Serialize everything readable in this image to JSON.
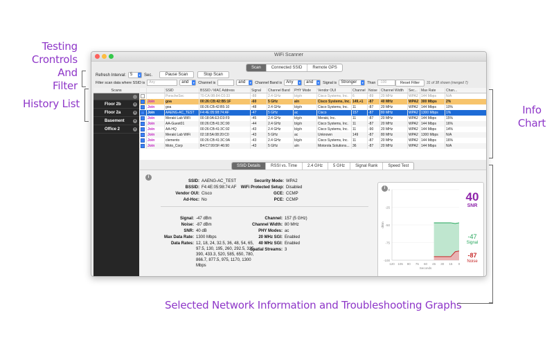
{
  "callouts": {
    "filter_l1": "Testing",
    "filter_l2": "Crontrols",
    "filter_l3": "And Filter",
    "history": "History List",
    "info_l1": "Info",
    "info_l2": "Chart",
    "selected": "Selected Network Information and Troubleshooting Graphs"
  },
  "window": {
    "title": "WiFi Scanner",
    "tabs": [
      "Scan",
      "Connected SSID",
      "Remote GPS"
    ]
  },
  "controls": {
    "refresh_label": "Refresh Interval:",
    "refresh_value": "5",
    "refresh_unit": "Sec.",
    "pause": "Pause Scan",
    "stop": "Stop Scan",
    "filter_label": "Filter scan data where SSID is",
    "ssid_placeholder": "Any",
    "and1": "and",
    "channel_is": "Channel is",
    "and2": "and",
    "channel_band_is": "Channel Band is",
    "band_value": "Any",
    "and3": "and",
    "signal_is": "Signal is",
    "signal_value": "Stronger",
    "than": "Than",
    "than_value": "-100",
    "reset": "Reset Filter",
    "shown": "31 of 38 shown (merged 7)"
  },
  "sidebar": {
    "header": "Scans",
    "items": [
      "Floor 2b",
      "Floor 2a",
      "Basement",
      "Office 2"
    ]
  },
  "table": {
    "headers": [
      "",
      "SSID",
      "BSSID / MAC Address",
      "Signal",
      "Channel Band",
      "PHY Mode",
      "Vendor OUI",
      "Channel",
      "Noise",
      "Channel Width",
      "Sec...",
      "Max Rate",
      "Chan..."
    ],
    "rows": [
      {
        "ssid": "PorscheSvc",
        "bssid": "70:CA:9B:84:C0:33",
        "signal": "-88",
        "band": "2.4 GHz",
        "phy": "b/g/n",
        "vendor": "Cisco Systems, Inc.",
        "channel": "6",
        "noise": "-89",
        "width": "20 MHz",
        "sec": "WPA2",
        "rate": "144 Mbps",
        "chan": "N/A"
      },
      {
        "ssid": "goa",
        "bssid": "00:26:CB:42:B5:1F",
        "signal": "-60",
        "band": "5 GHz",
        "phy": "a/n",
        "vendor": "Cisco Systems, Inc.",
        "channel": "149,+1",
        "noise": "-87",
        "width": "40 MHz",
        "sec": "WPA2",
        "rate": "300 Mbps",
        "chan": "2%"
      },
      {
        "ssid": "goa",
        "bssid": "00:26:CB:42:B5:10",
        "signal": "-48",
        "band": "2.4 GHz",
        "phy": "b/g/n",
        "vendor": "Cisco Systems, Inc.",
        "channel": "11",
        "noise": "-87",
        "width": "20 MHz",
        "sec": "WPA2",
        "rate": "144 Mbps",
        "chan": "10%"
      },
      {
        "ssid": "AAENG-AC_TEST",
        "bssid": "F4:4E:05:98:74:AF",
        "signal": "-47",
        "band": "5 GHz",
        "phy": "ac",
        "vendor": "Cisco",
        "channel": "157",
        "noise": "-87",
        "width": "80 MHz",
        "sec": "WPA2",
        "rate": "1300 Mbps",
        "chan": "1%"
      },
      {
        "ssid": "Meraki Lab WiFi",
        "bssid": "00:18:0A:E3:D3:F9",
        "signal": "-45",
        "band": "2.4 GHz",
        "phy": "b/g/n",
        "vendor": "Meraki, Inc.",
        "channel": "11",
        "noise": "-87",
        "width": "20 MHz",
        "sec": "WPA2",
        "rate": "144 Mbps",
        "chan": "15%"
      },
      {
        "ssid": "AA-Guest01",
        "bssid": "00:26:CB:41:3C:90",
        "signal": "-44",
        "band": "2.4 GHz",
        "phy": "b/g/n",
        "vendor": "Cisco Systems, Inc.",
        "channel": "11",
        "noise": "-87",
        "width": "20 MHz",
        "sec": "WPA2",
        "rate": "144 Mbps",
        "chan": "16%"
      },
      {
        "ssid": "AA-HQ",
        "bssid": "00:26:CB:41:3C:92",
        "signal": "-43",
        "band": "2.4 GHz",
        "phy": "b/g/n",
        "vendor": "Cisco Systems, Inc.",
        "channel": "11",
        "noise": "-90",
        "width": "20 MHz",
        "sec": "WPA2",
        "rate": "144 Mbps",
        "chan": "14%"
      },
      {
        "ssid": "Meraki Lab WiFi",
        "bssid": "02:18:5A:08:20:C0",
        "signal": "-43",
        "band": "5 GHz",
        "phy": "ac",
        "vendor": "Unknown",
        "channel": "149",
        "noise": "-87",
        "width": "80 MHz",
        "sec": "WPA2",
        "rate": "1300 Mbps",
        "chan": "N/A"
      },
      {
        "ssid": "clemento",
        "bssid": "00:26:CB:41:3C:9A",
        "signal": "-43",
        "band": "2.4 GHz",
        "phy": "b/g/n",
        "vendor": "Cisco Systems, Inc.",
        "channel": "11",
        "noise": "-87",
        "width": "20 MHz",
        "sec": "WPA2",
        "rate": "144 Mbps",
        "chan": "16%"
      },
      {
        "ssid": "Moto_Corp",
        "bssid": "B4:C7:99:5F:46:90",
        "signal": "-43",
        "band": "5 GHz",
        "phy": "a/n",
        "vendor": "Motorola Solutions...",
        "channel": "36",
        "noise": "-87",
        "width": "20 MHz",
        "sec": "WPA2",
        "rate": "144 Mbps",
        "chan": "N/A"
      }
    ],
    "join_label": "Join"
  },
  "detail_tabs": [
    "SSID Details",
    "RSSI vs. Time",
    "2.4 GHz",
    "5 GHz",
    "Signal Rank",
    "Speed Test"
  ],
  "details": {
    "ssid_k": "SSID:",
    "ssid_v": "AAENG-AC_TEST",
    "bssid_k": "BSSID:",
    "bssid_v": "F4:4E:05:98:74:AF",
    "vendor_k": "Vendor OUI:",
    "vendor_v": "Cisco",
    "adhoc_k": "Ad-Hoc:",
    "adhoc_v": "No",
    "sec_k": "Security Mode:",
    "sec_v": "WPA2",
    "wps_k": "WiFi Protected Setup:",
    "wps_v": "Disabled",
    "gce_k": "GCE:",
    "gce_v": "CCMP",
    "pce_k": "PCE:",
    "pce_v": "CCMP",
    "signal_k": "Signal:",
    "signal_v": "-47 dBm",
    "noise_k": "Noise:",
    "noise_v": "-87 dBm",
    "snr_k": "SNR:",
    "snr_v": "40 dB",
    "maxrate_k": "Max Data Rate:",
    "maxrate_v": "1300 Mbps",
    "rates_k": "Data Rates:",
    "rates_v1": "12, 18, 24, 32.5, 36, 48, 54, 65,",
    "rates_v2": "97.5, 130, 195, 260, 292.5, 325,",
    "rates_v3": "390, 433.3, 520, 585, 650, 780,",
    "rates_v4": "866.7, 877.5, 975, 1170, 1300",
    "rates_v5": "Mbps",
    "channel_k": "Channel:",
    "channel_v": "157 (5 GHz)",
    "width_k": "Channel Width:",
    "width_v": "80 MHz",
    "phy_k": "PHY Modes:",
    "phy_v": "ac",
    "sgi20_k": "20 MHz SGI:",
    "sgi20_v": "Enabled",
    "sgi40_k": "40 MHz SGI:",
    "sgi40_v": "Enabled",
    "streams_k": "Spatial Streams:",
    "streams_v": "3"
  },
  "graph": {
    "snr_value": "40",
    "snr_label": "SNR",
    "signal_value": "-47",
    "signal_label": "Signal",
    "noise_value": "-87",
    "noise_label": "Noise",
    "y_label": "dBm",
    "x_label": "Seconds",
    "y_ticks": [
      "0",
      "-25",
      "-50",
      "-75",
      "-100"
    ],
    "x_ticks": [
      "120",
      "105",
      "90",
      "75",
      "60",
      "45",
      "30",
      "15",
      "0"
    ],
    "colors": {
      "snr": "#8e24aa",
      "signal": "#26a65b",
      "noise": "#c62828"
    }
  },
  "chart_data": {
    "type": "area",
    "xlabel": "Seconds",
    "ylabel": "dBm",
    "xlim": [
      120,
      0
    ],
    "ylim": [
      -100,
      0
    ],
    "x": [
      120,
      105,
      90,
      75,
      60,
      45,
      30,
      15,
      7,
      0
    ],
    "series": [
      {
        "name": "Signal",
        "values": [
          null,
          null,
          null,
          null,
          null,
          -47,
          -47,
          -47,
          -48,
          -47
        ]
      },
      {
        "name": "Noise",
        "values": [
          null,
          null,
          null,
          null,
          null,
          -95,
          -95,
          -95,
          -88,
          -87
        ]
      }
    ]
  }
}
